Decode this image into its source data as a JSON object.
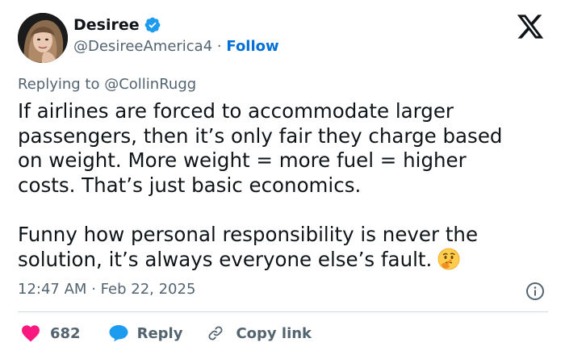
{
  "author": {
    "name": "Desiree",
    "handle": "@DesireeAmerica4",
    "separator": "·",
    "follow_label": "Follow"
  },
  "reply_context": {
    "prefix": "Replying to",
    "mention": "@CollinRugg"
  },
  "tweet": {
    "paragraph1": [
      "If airlines are forced to accommodate larger",
      "passengers, then it’s only fair they charge based",
      "on weight. More weight = more fuel = higher",
      "costs. That’s just basic economics."
    ],
    "paragraph2": [
      "Funny how personal responsibility is never the",
      "solution, it’s always everyone else’s fault."
    ],
    "emoji": "thinking-face-icon"
  },
  "meta": {
    "time": "12:47 AM",
    "separator": "·",
    "date": "Feb 22, 2025"
  },
  "actions": {
    "like_count": "682",
    "reply_label": "Reply",
    "copy_label": "Copy link"
  },
  "colors": {
    "follow_blue": "#006fd6",
    "verified_blue": "#1d9bf0",
    "like_red": "#f91880",
    "muted_text": "#536471",
    "divider": "#cfd9de"
  }
}
